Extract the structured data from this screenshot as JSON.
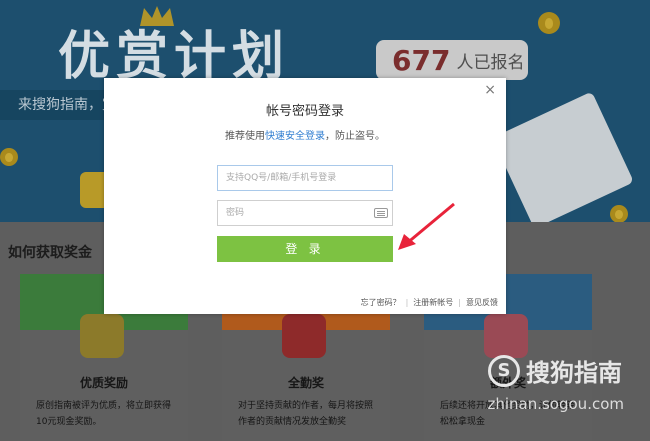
{
  "hero": {
    "title": "优赏计划",
    "count": "677",
    "count_unit": "人已报名",
    "banner_text": "来搜狗指南，赏"
  },
  "section": {
    "title": "如何获取奖金"
  },
  "cards": [
    {
      "title": "优质奖励",
      "desc": "原创指南被评为优质，将立即获得10元现金奖励。",
      "color": "#3b7b3b"
    },
    {
      "title": "全勤奖",
      "desc": "对于坚持贡献的作者，每月将按照作者的贡献情况发放全勤奖",
      "color": "#b05a1c"
    },
    {
      "title": "额外奖",
      "desc": "后续还将开放其他奖励，让你轻轻松松拿现金",
      "color": "#2b5c80"
    }
  ],
  "modal": {
    "close": "×",
    "title": "帐号密码登录",
    "tip_prefix": "推荐使用",
    "tip_link": "快速安全登录",
    "tip_suffix": "，防止盗号。",
    "user_placeholder": "支持QQ号/邮箱/手机号登录",
    "pass_placeholder": "密码",
    "login_label": "登 录",
    "links": [
      "忘了密码？",
      "注册新帐号",
      "意见反馈"
    ]
  },
  "watermark": {
    "brand": "搜狗指南",
    "url": "zhinan.sogou.com"
  },
  "colors": {
    "accent": "#7dc242",
    "link": "#2f7dd0",
    "arrow": "#e8233a"
  }
}
